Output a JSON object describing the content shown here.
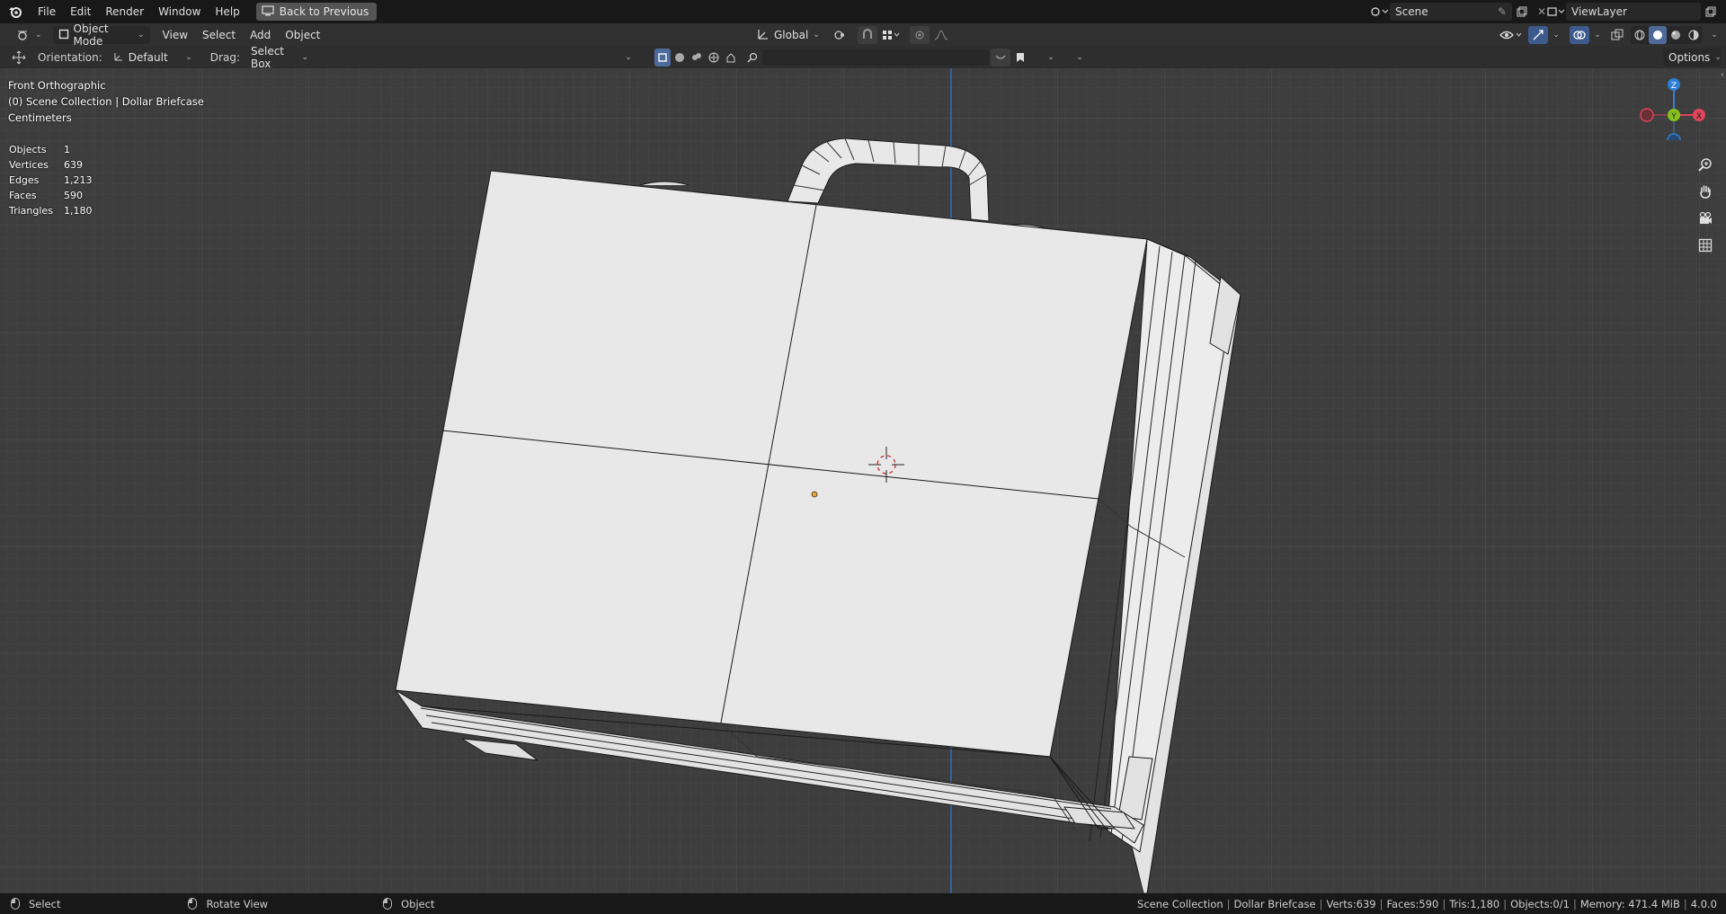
{
  "topbar": {
    "menus": [
      "File",
      "Edit",
      "Render",
      "Window",
      "Help"
    ],
    "back_button": "Back to Previous",
    "scene_name": "Scene",
    "view_layer_name": "ViewLayer"
  },
  "header": {
    "mode": "Object Mode",
    "menus": [
      "View",
      "Select",
      "Add",
      "Object"
    ],
    "transform_orientation": "Global"
  },
  "tool_header": {
    "orientation_label": "Orientation:",
    "orientation_value": "Default",
    "drag_label": "Drag:",
    "drag_value": "Select Box",
    "options_label": "Options",
    "search_placeholder": ""
  },
  "viewport": {
    "view_name": "Front Orthographic",
    "collection_info": "(0) Scene Collection | Dollar Briefcase",
    "units": "Centimeters",
    "stats": [
      {
        "label": "Objects",
        "value": "1"
      },
      {
        "label": "Vertices",
        "value": "639"
      },
      {
        "label": "Edges",
        "value": "1,213"
      },
      {
        "label": "Faces",
        "value": "590"
      },
      {
        "label": "Triangles",
        "value": "1,180"
      }
    ],
    "gizmo_axes": {
      "z": "Z",
      "y": "Y",
      "x": "X"
    },
    "colors": {
      "x_axis": "#e0455a",
      "y_axis": "#85c21d",
      "z_axis": "#2f7fd6",
      "background": "#3d3d3d",
      "mesh": "#e8e8e8"
    }
  },
  "statusbar": {
    "left_action": "Select",
    "middle_action": "Rotate View",
    "right_action": "Object",
    "collection": "Scene Collection",
    "object": "Dollar Briefcase",
    "verts": "Verts:639",
    "faces": "Faces:590",
    "tris": "Tris:1,180",
    "objects": "Objects:0/1",
    "memory": "Memory: 471.4 MiB",
    "version": "4.0.0"
  }
}
